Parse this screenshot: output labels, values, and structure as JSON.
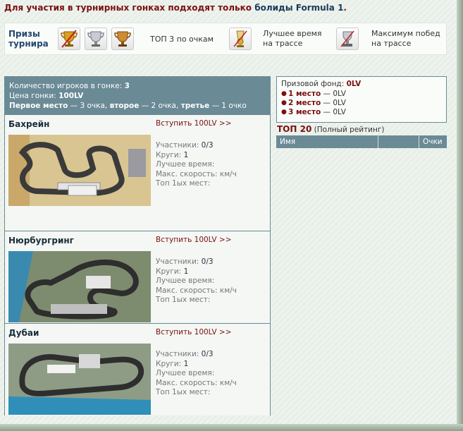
{
  "notice": {
    "text": "Для участия в турнирных гонках подходят только ",
    "accent": "болиды Formula 1",
    "end": "."
  },
  "prizes": {
    "label_line1": "Призы",
    "label_line2": "турнира",
    "top3": "ТОП 3 по очкам",
    "best_time_line1": "Лучшее время",
    "best_time_line2": "на трассе",
    "max_wins_line1": "Максимум побед",
    "max_wins_line2": "на трассе"
  },
  "info": {
    "players_label": "Количество игроков в гонке: ",
    "players_value": "3",
    "price_label": "Цена гонки: ",
    "price_value": "100LV",
    "first_label": "Первое место",
    "first_text": " — 3 очка, ",
    "second_label": "второе",
    "second_text": " — 2 очка, ",
    "third_label": "третье",
    "third_text": " — 1 очко"
  },
  "stat_labels": {
    "participants": "Участники: ",
    "laps": "Круги: ",
    "best_time": "Лучшее время:",
    "max_speed": "Макс. скорость: км/ч",
    "top_first": "Топ 1ых мест:"
  },
  "tracks": [
    {
      "name": "Бахрейн",
      "join": "Вступить 100LV >>",
      "participants": "0/3",
      "laps": "1"
    },
    {
      "name": "Нюрбургринг",
      "join": "Вступить 100LV >>",
      "participants": "0/3",
      "laps": "1"
    },
    {
      "name": "Дубаи",
      "join": "Вступить 100LV >>",
      "participants": "0/3",
      "laps": "1"
    }
  ],
  "fund": {
    "label": "Призовой фонд: ",
    "value": "0LV",
    "places": [
      {
        "place": "1 место",
        "value": " — 0LV"
      },
      {
        "place": "2 место",
        "value": " — 0LV"
      },
      {
        "place": "3 место",
        "value": " — 0LV"
      }
    ]
  },
  "rating": {
    "title": "ТОП 20",
    "full": " (Полный рейтинг)",
    "col_name": "Имя",
    "col_points": "Очки"
  },
  "colors": {
    "accent_red": "#7a1010",
    "panel_header": "#6a8a96",
    "background": "#e8efe8"
  }
}
